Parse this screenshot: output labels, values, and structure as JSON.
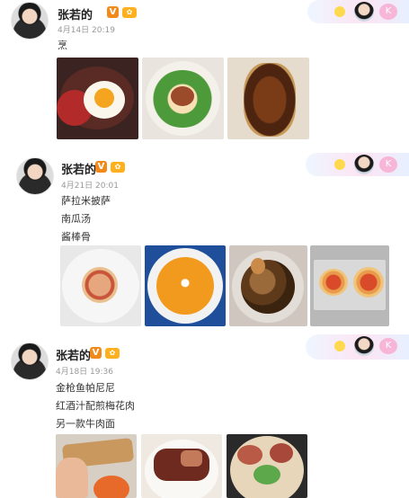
{
  "posts": [
    {
      "name": "张若的",
      "time": "4月14日 20:19",
      "lines": [
        "烹"
      ],
      "banner_label": "K"
    },
    {
      "name": "张若的",
      "time": "4月21日 20:01",
      "lines": [
        "萨拉米披萨",
        "南瓜汤",
        "酱棒骨"
      ],
      "banner_label": "K"
    },
    {
      "name": "张若的",
      "time": "4月18日 19:36",
      "lines": [
        "金枪鱼帕尼尼",
        "红酒汁配煎梅花肉",
        "另一款牛肉面"
      ],
      "banner_label": "K"
    }
  ],
  "badges": {
    "verified": "V",
    "vip": "✿"
  },
  "colors": {
    "verified_orange": "#f28a1b",
    "vip_yellow": "#ffb01f"
  }
}
